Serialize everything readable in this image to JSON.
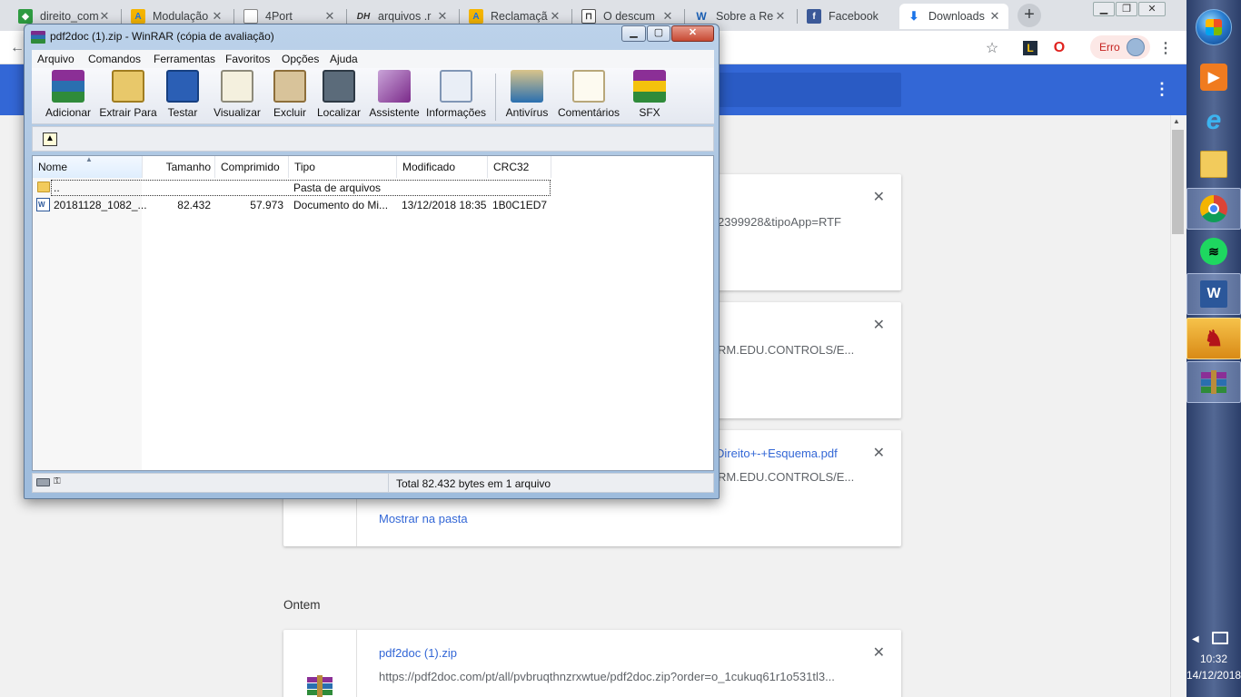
{
  "browser": {
    "tabs": [
      {
        "title": "direito_com",
        "favicon_icon": "brazil-flag-icon"
      },
      {
        "title": "Modulação",
        "favicon_icon": "adsense-icon"
      },
      {
        "title": "4Port",
        "favicon_icon": "page-icon"
      },
      {
        "title": "arquivos .r",
        "favicon_icon": "dh-icon"
      },
      {
        "title": "Reclamaçã",
        "favicon_icon": "adsense-icon"
      },
      {
        "title": "O descum",
        "favicon_icon": "bookmark-icon"
      },
      {
        "title": "Sobre a Re",
        "favicon_icon": "w-icon"
      },
      {
        "title": "Facebook",
        "favicon_icon": "facebook-icon"
      },
      {
        "title": "Downloads",
        "favicon_icon": "download-icon"
      }
    ],
    "profile_error_label": "Erro",
    "header_color": "#3367d6"
  },
  "downloads": {
    "cards": [
      {
        "file_name": "",
        "url": "2399928&tipoApp=RTF",
        "action": ""
      },
      {
        "file_name": "",
        "url": "RM.EDU.CONTROLS/E...",
        "action": ""
      },
      {
        "file_name": "Direito+-+Esquema.pdf",
        "url": "RM.EDU.CONTROLS/E...",
        "action": "Mostrar na pasta"
      },
      {
        "file_name": "pdf2doc (1).zip",
        "url": "https://pdf2doc.com/pt/all/pvbruqthnzrxwtue/pdf2doc.zip?order=o_1cukuq61r1o531tl3...",
        "action": ""
      }
    ],
    "date_heading": "Ontem"
  },
  "winrar": {
    "title": "pdf2doc (1).zip - WinRAR (cópia de avaliação)",
    "menu": [
      "Arquivo",
      "Comandos",
      "Ferramentas",
      "Favoritos",
      "Opções",
      "Ajuda"
    ],
    "toolbar": [
      "Adicionar",
      "Extrair Para",
      "Testar",
      "Visualizar",
      "Excluir",
      "Localizar",
      "Assistente",
      "Informações",
      "Antivírus",
      "Comentários",
      "SFX"
    ],
    "columns": [
      "Nome",
      "Tamanho",
      "Comprimido",
      "Tipo",
      "Modificado",
      "CRC32"
    ],
    "rows": [
      {
        "name": "..",
        "size": "",
        "packed": "",
        "type": "Pasta de arquivos",
        "modified": "",
        "crc": ""
      },
      {
        "name": "20181128_1082_...",
        "size": "82.432",
        "packed": "57.973",
        "type": "Documento do Mi...",
        "modified": "13/12/2018 18:35",
        "crc": "1B0C1ED7"
      }
    ],
    "status": "Total 82.432 bytes em 1 arquivo"
  },
  "taskbar": {
    "time": "10:32",
    "date": "14/12/2018"
  }
}
